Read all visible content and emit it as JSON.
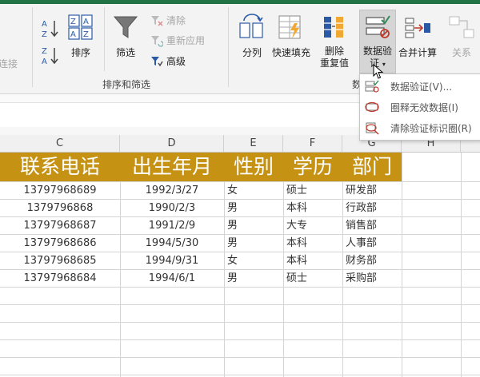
{
  "ribbon": {
    "link_label": "连接",
    "sort_asc_icon": "sort-az-icon",
    "sort_desc_icon": "sort-za-icon",
    "sort_label": "排序",
    "filter_label": "筛选",
    "clear_label": "清除",
    "reapply_label": "重新应用",
    "advanced_label": "高级",
    "group_sort_filter": "排序和筛选",
    "split_label": "分列",
    "flash_fill_label": "快速填充",
    "remove_dup_line1": "删除",
    "remove_dup_line2": "重复值",
    "validation_line1": "数据验",
    "validation_line2": "证",
    "consolidate_label": "合并计算",
    "relationships_label": "关系",
    "group_data_tools_partial": "数"
  },
  "dropdown": {
    "items": [
      {
        "label": "数据验证(V)...",
        "icon": "data-validation-icon"
      },
      {
        "label": "圈释无效数据(I)",
        "icon": "circle-invalid-icon"
      },
      {
        "label": "清除验证标识圈(R)",
        "icon": "clear-circles-icon"
      }
    ]
  },
  "columns": [
    "C",
    "D",
    "E",
    "F",
    "G",
    "H"
  ],
  "table": {
    "headers": [
      "联系电话",
      "出生年月",
      "性别",
      "学历",
      "部门"
    ],
    "rows": [
      [
        "13797968689",
        "1992/3/27",
        "女",
        "硕士",
        "研发部"
      ],
      [
        "1379796868",
        "1990/2/3",
        "男",
        "本科",
        "行政部"
      ],
      [
        "13797968687",
        "1991/2/9",
        "男",
        "大专",
        "销售部"
      ],
      [
        "13797968686",
        "1994/5/30",
        "男",
        "本科",
        "人事部"
      ],
      [
        "13797968685",
        "1994/9/31",
        "女",
        "本科",
        "财务部"
      ],
      [
        "13797968684",
        "1994/6/1",
        "男",
        "硕士",
        "采购部"
      ]
    ]
  },
  "colors": {
    "excel_green": "#217346",
    "header_fill": "#c69214",
    "header_text": "#ffffff"
  }
}
